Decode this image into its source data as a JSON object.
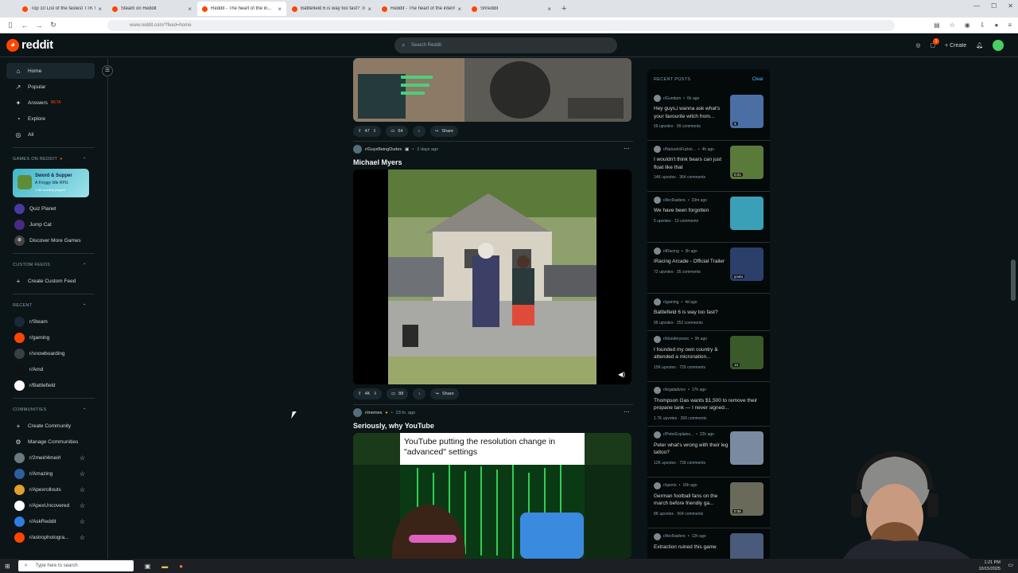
{
  "browser": {
    "tabs": [
      {
        "label": "Top 10 List of the fastest TTK W...",
        "active": false
      },
      {
        "label": "Steam on Reddit",
        "active": false
      },
      {
        "label": "Reddit - The heart of the in...",
        "active": true
      },
      {
        "label": "Battlefield 6 is way too fast? :r/...",
        "active": false
      },
      {
        "label": "Reddit - The heart of the intern...",
        "active": false
      },
      {
        "label": "Shreddit",
        "active": false
      }
    ],
    "url": "www.reddit.com/?feed=home"
  },
  "header": {
    "logo": "reddit",
    "search_placeholder": "Search Reddit",
    "create_label": "Create",
    "chat_badge": "1"
  },
  "sidebar": {
    "main": [
      {
        "label": "Home",
        "icon": "home-icon"
      },
      {
        "label": "Popular",
        "icon": "popular-icon"
      },
      {
        "label": "Answers",
        "icon": "answers-icon",
        "badge": "BETA"
      },
      {
        "label": "Explore",
        "icon": "explore-icon"
      },
      {
        "label": "All",
        "icon": "all-icon"
      }
    ],
    "games_heading": "GAMES ON REDDIT",
    "game_card": {
      "title": "Sword & Supper",
      "subtitle": "A Froggy Idle RPG",
      "users": "1.2M monthly players"
    },
    "games": [
      "Quiz Planet",
      "Jump Cat",
      "Discover More Games"
    ],
    "custom_feeds_heading": "CUSTOM FEEDS",
    "create_custom_feed": "Create Custom Feed",
    "recent_heading": "RECENT",
    "recent": [
      {
        "label": "r/Steam",
        "color": "#1b2838"
      },
      {
        "label": "r/gaming",
        "color": "#ff4500"
      },
      {
        "label": "r/snowboarding",
        "color": "#3a3f44"
      },
      {
        "label": "r/Amd",
        "color": "#111111"
      },
      {
        "label": "r/Battlefield",
        "color": "#ffffff"
      }
    ],
    "communities_heading": "COMMUNITIES",
    "create_community": "Create Community",
    "manage_communities": "Manage Communities",
    "communities": [
      {
        "label": "r/2meirl4meirl",
        "color": "#6b7a80"
      },
      {
        "label": "r/Amazing",
        "color": "#2c5f9e"
      },
      {
        "label": "r/Apexrollouts",
        "color": "#e0a030"
      },
      {
        "label": "r/ApexUncovered",
        "color": "#ffffff"
      },
      {
        "label": "r/AskReddit",
        "color": "#2f7de1"
      },
      {
        "label": "r/astrophotogra...",
        "color": "#ff4500"
      }
    ]
  },
  "feed": {
    "post1": {
      "upvotes": "47",
      "comments": "64",
      "share": "Share"
    },
    "post2": {
      "subreddit": "r/GuysBeingDudes",
      "time": "2 days ago",
      "title": "Michael Myers",
      "upvotes": "4K",
      "comments": "88",
      "share": "Share"
    },
    "post3": {
      "subreddit": "r/memes",
      "time": "23 hr. ago",
      "title": "Seriously, why YouTube",
      "meme_text": "YouTube putting the resolution change in \"advanced\" settings"
    }
  },
  "recent_posts": {
    "heading": "RECENT POSTS",
    "clear": "Clear",
    "items": [
      {
        "sub": "r/Gundam",
        "time": "6h ago",
        "title": "Hey guys,i wanna ask what's your favourite witch from...",
        "stats": "56 upvotes · 99 comments",
        "badge": "3",
        "thumb": "#4a6fa5"
      },
      {
        "sub": "r/NatureIsFuckin...",
        "time": "4h ago",
        "title": "I wouldn't think bears can just float like that",
        "stats": "14K upvotes · 364 comments",
        "badge": "0:21",
        "thumb": "#5a7a3a"
      },
      {
        "sub": "r/ArcRaiders",
        "time": "33m ago",
        "title": "We have been forgotten",
        "stats": "5 upvotes · 13 comments",
        "badge": "",
        "thumb": "#3aa0b8"
      },
      {
        "sub": "r/iRacing",
        "time": "3h ago",
        "title": "iRacing Arcade - Official Trailer",
        "stats": "72 upvotes · 35 comments",
        "badge": "youtu",
        "thumb": "#2a3f6a"
      },
      {
        "sub": "r/gaming",
        "time": "4d ago",
        "title": "Battlefield 6 is way too fast?",
        "stats": "95 upvotes · 252 comments",
        "badge": "",
        "thumb": ""
      },
      {
        "sub": "r/blunderyears",
        "time": "9h ago",
        "title": "I founded my own country & attended a micronation...",
        "stats": "15K upvotes · 729 comments",
        "badge": "13",
        "thumb": "#3a5a2a"
      },
      {
        "sub": "r/legaladvice",
        "time": "17h ago",
        "title": "Thompson Gas wants $1,500 to remove their propane tank — I never signed...",
        "stats": "1.7K upvotes · 266 comments",
        "badge": "",
        "thumb": ""
      },
      {
        "sub": "r/PeterExplains...",
        "time": "22h ago",
        "title": "Peter what's wrong with their leg tattoo?",
        "stats": "12K upvotes · 739 comments",
        "badge": "",
        "thumb": "#7a8aa0"
      },
      {
        "sub": "r/sports",
        "time": "16h ago",
        "title": "German football fans on the march before friendly ga...",
        "stats": "8K upvotes · 564 comments",
        "badge": "0:35",
        "thumb": "#6a6a5a"
      },
      {
        "sub": "r/ArcRaiders",
        "time": "12h ago",
        "title": "Extraction ruined this game",
        "stats": "",
        "badge": "",
        "thumb": "#4a5a7a"
      }
    ]
  },
  "taskbar": {
    "search_placeholder": "Type here to search",
    "time": "1:21 PM",
    "date": "10/15/2025"
  }
}
